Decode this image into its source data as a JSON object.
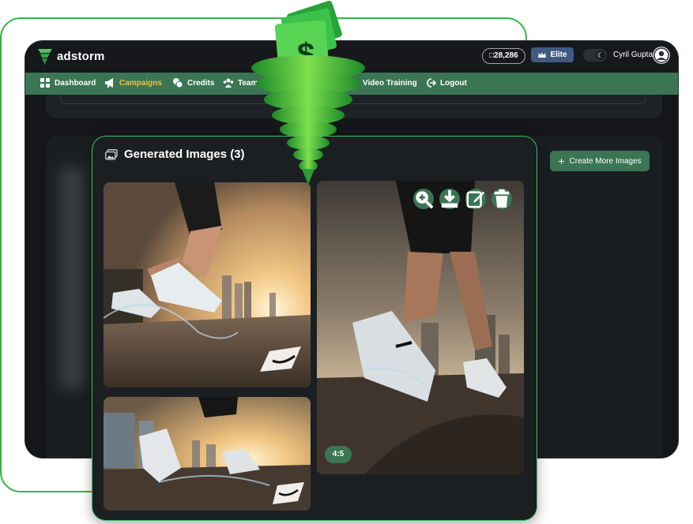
{
  "app": {
    "brand_prefix": "ad",
    "brand_suffix": "storm",
    "credits": "□28,286",
    "plan_label": "Elite",
    "user_name": "Cyril Gupta"
  },
  "nav": {
    "items": [
      {
        "label": "Dashboard",
        "icon": "dashboard-icon"
      },
      {
        "label": "Campaigns",
        "icon": "megaphone-icon",
        "active": true
      },
      {
        "label": "Credits",
        "icon": "coins-icon"
      },
      {
        "label": "Team",
        "icon": "team-icon"
      },
      {
        "label": "Video Training",
        "icon": "video-icon"
      },
      {
        "label": "Logout",
        "icon": "logout-icon"
      }
    ]
  },
  "actions": {
    "create_more": "Create More Images"
  },
  "gallery": {
    "title": "Generated Images (3)",
    "tools": [
      "zoom-icon",
      "download-icon",
      "edit-icon",
      "delete-icon"
    ],
    "ratio_badge": "4:5"
  },
  "colors": {
    "brand_green": "#3b7554",
    "accent_green": "#3fbf5f",
    "active_nav": "#f3c03a",
    "elite_blue": "#3f5b82"
  }
}
